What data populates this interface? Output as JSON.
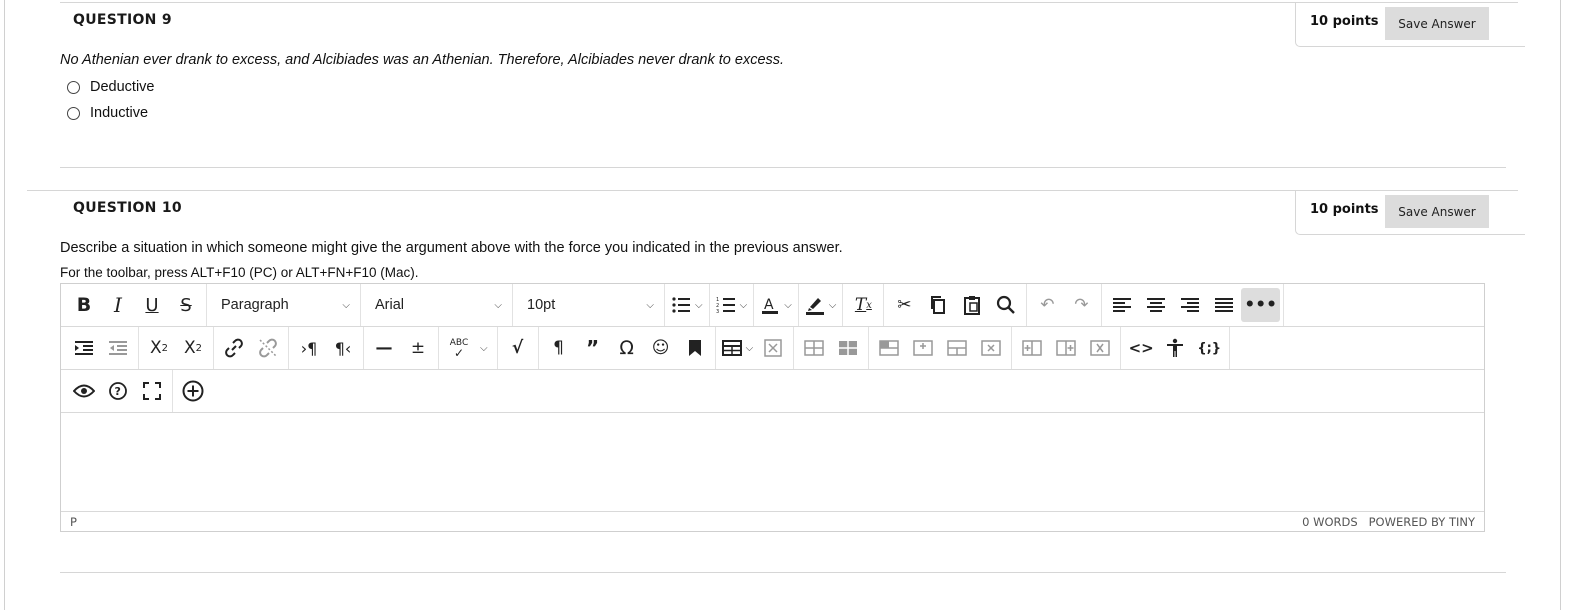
{
  "question9": {
    "title": "QUESTION 9",
    "points": "10 points",
    "save_label": "Save Answer",
    "prompt": "No Athenian ever drank to excess, and Alcibiades was an Athenian. Therefore, Alcibiades never drank to excess.",
    "options": [
      "Deductive",
      "Inductive"
    ]
  },
  "question10": {
    "title": "QUESTION 10",
    "points": "10 points",
    "save_label": "Save Answer",
    "prompt": "Describe a situation in which someone might give the argument above with the force you indicated in the previous answer.",
    "toolbar_hint": "For the toolbar, press ALT+F10 (PC) or ALT+FN+F10 (Mac)."
  },
  "editor": {
    "block_format": "Paragraph",
    "font_family": "Arial",
    "font_size": "10pt",
    "path": "P",
    "word_count": "0 WORDS",
    "powered_by": "POWERED BY TINY",
    "toolbar_row1_icons": [
      "bold-icon",
      "italic-icon",
      "underline-icon",
      "strikethrough-icon",
      "bullet-list-icon",
      "numbered-list-icon",
      "text-color-icon",
      "highlight-icon",
      "clear-format-icon",
      "cut-icon",
      "copy-icon",
      "paste-icon",
      "find-icon",
      "undo-icon",
      "redo-icon",
      "align-left-icon",
      "align-center-icon",
      "align-right-icon",
      "justify-icon",
      "more-icon"
    ],
    "toolbar_row2_icons": [
      "indent-icon",
      "outdent-icon",
      "superscript-icon",
      "subscript-icon",
      "link-icon",
      "unlink-icon",
      "ltr-icon",
      "rtl-icon",
      "horizontal-rule-icon",
      "plus-minus-icon",
      "spellcheck-icon",
      "math-icon",
      "paragraph-mark-icon",
      "blockquote-icon",
      "special-char-icon",
      "emoji-icon",
      "bookmark-icon",
      "table-icon",
      "delete-table-icon",
      "table-cell-icons",
      "code-icon",
      "accessibility-icon",
      "template-icon"
    ],
    "toolbar_row3_icons": [
      "preview-icon",
      "help-icon",
      "fullscreen-icon",
      "add-content-icon"
    ]
  }
}
